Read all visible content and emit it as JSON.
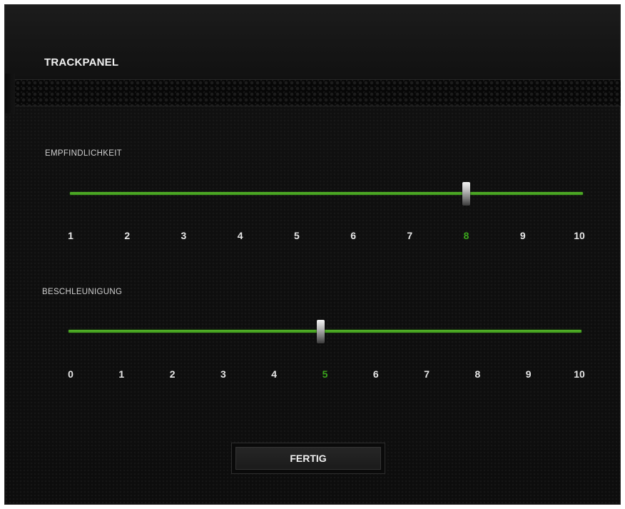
{
  "panel": {
    "title": "TRACKPANEL"
  },
  "sensitivity": {
    "label": "EMPFINDLICHKEIT",
    "value": 8,
    "min": 1,
    "max": 10,
    "ticks": [
      "1",
      "2",
      "3",
      "4",
      "5",
      "6",
      "7",
      "8",
      "9",
      "10"
    ]
  },
  "acceleration": {
    "label": "BESCHLEUNIGUNG",
    "value": 5,
    "min": 0,
    "max": 10,
    "ticks": [
      "0",
      "1",
      "2",
      "3",
      "4",
      "5",
      "6",
      "7",
      "8",
      "9",
      "10"
    ]
  },
  "actions": {
    "done_label": "FERTIG"
  },
  "colors": {
    "accent": "#44a820",
    "background": "#0d0d0d",
    "text": "#e6e6e6"
  }
}
